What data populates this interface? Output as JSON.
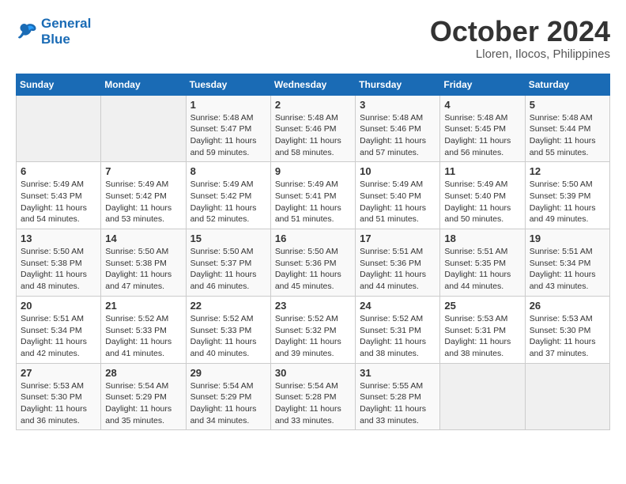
{
  "header": {
    "logo_line1": "General",
    "logo_line2": "Blue",
    "month": "October 2024",
    "location": "Lloren, Ilocos, Philippines"
  },
  "weekdays": [
    "Sunday",
    "Monday",
    "Tuesday",
    "Wednesday",
    "Thursday",
    "Friday",
    "Saturday"
  ],
  "weeks": [
    [
      {
        "day": "",
        "info": ""
      },
      {
        "day": "",
        "info": ""
      },
      {
        "day": "1",
        "info": "Sunrise: 5:48 AM\nSunset: 5:47 PM\nDaylight: 11 hours and 59 minutes."
      },
      {
        "day": "2",
        "info": "Sunrise: 5:48 AM\nSunset: 5:46 PM\nDaylight: 11 hours and 58 minutes."
      },
      {
        "day": "3",
        "info": "Sunrise: 5:48 AM\nSunset: 5:46 PM\nDaylight: 11 hours and 57 minutes."
      },
      {
        "day": "4",
        "info": "Sunrise: 5:48 AM\nSunset: 5:45 PM\nDaylight: 11 hours and 56 minutes."
      },
      {
        "day": "5",
        "info": "Sunrise: 5:48 AM\nSunset: 5:44 PM\nDaylight: 11 hours and 55 minutes."
      }
    ],
    [
      {
        "day": "6",
        "info": "Sunrise: 5:49 AM\nSunset: 5:43 PM\nDaylight: 11 hours and 54 minutes."
      },
      {
        "day": "7",
        "info": "Sunrise: 5:49 AM\nSunset: 5:42 PM\nDaylight: 11 hours and 53 minutes."
      },
      {
        "day": "8",
        "info": "Sunrise: 5:49 AM\nSunset: 5:42 PM\nDaylight: 11 hours and 52 minutes."
      },
      {
        "day": "9",
        "info": "Sunrise: 5:49 AM\nSunset: 5:41 PM\nDaylight: 11 hours and 51 minutes."
      },
      {
        "day": "10",
        "info": "Sunrise: 5:49 AM\nSunset: 5:40 PM\nDaylight: 11 hours and 51 minutes."
      },
      {
        "day": "11",
        "info": "Sunrise: 5:49 AM\nSunset: 5:40 PM\nDaylight: 11 hours and 50 minutes."
      },
      {
        "day": "12",
        "info": "Sunrise: 5:50 AM\nSunset: 5:39 PM\nDaylight: 11 hours and 49 minutes."
      }
    ],
    [
      {
        "day": "13",
        "info": "Sunrise: 5:50 AM\nSunset: 5:38 PM\nDaylight: 11 hours and 48 minutes."
      },
      {
        "day": "14",
        "info": "Sunrise: 5:50 AM\nSunset: 5:38 PM\nDaylight: 11 hours and 47 minutes."
      },
      {
        "day": "15",
        "info": "Sunrise: 5:50 AM\nSunset: 5:37 PM\nDaylight: 11 hours and 46 minutes."
      },
      {
        "day": "16",
        "info": "Sunrise: 5:50 AM\nSunset: 5:36 PM\nDaylight: 11 hours and 45 minutes."
      },
      {
        "day": "17",
        "info": "Sunrise: 5:51 AM\nSunset: 5:36 PM\nDaylight: 11 hours and 44 minutes."
      },
      {
        "day": "18",
        "info": "Sunrise: 5:51 AM\nSunset: 5:35 PM\nDaylight: 11 hours and 44 minutes."
      },
      {
        "day": "19",
        "info": "Sunrise: 5:51 AM\nSunset: 5:34 PM\nDaylight: 11 hours and 43 minutes."
      }
    ],
    [
      {
        "day": "20",
        "info": "Sunrise: 5:51 AM\nSunset: 5:34 PM\nDaylight: 11 hours and 42 minutes."
      },
      {
        "day": "21",
        "info": "Sunrise: 5:52 AM\nSunset: 5:33 PM\nDaylight: 11 hours and 41 minutes."
      },
      {
        "day": "22",
        "info": "Sunrise: 5:52 AM\nSunset: 5:33 PM\nDaylight: 11 hours and 40 minutes."
      },
      {
        "day": "23",
        "info": "Sunrise: 5:52 AM\nSunset: 5:32 PM\nDaylight: 11 hours and 39 minutes."
      },
      {
        "day": "24",
        "info": "Sunrise: 5:52 AM\nSunset: 5:31 PM\nDaylight: 11 hours and 38 minutes."
      },
      {
        "day": "25",
        "info": "Sunrise: 5:53 AM\nSunset: 5:31 PM\nDaylight: 11 hours and 38 minutes."
      },
      {
        "day": "26",
        "info": "Sunrise: 5:53 AM\nSunset: 5:30 PM\nDaylight: 11 hours and 37 minutes."
      }
    ],
    [
      {
        "day": "27",
        "info": "Sunrise: 5:53 AM\nSunset: 5:30 PM\nDaylight: 11 hours and 36 minutes."
      },
      {
        "day": "28",
        "info": "Sunrise: 5:54 AM\nSunset: 5:29 PM\nDaylight: 11 hours and 35 minutes."
      },
      {
        "day": "29",
        "info": "Sunrise: 5:54 AM\nSunset: 5:29 PM\nDaylight: 11 hours and 34 minutes."
      },
      {
        "day": "30",
        "info": "Sunrise: 5:54 AM\nSunset: 5:28 PM\nDaylight: 11 hours and 33 minutes."
      },
      {
        "day": "31",
        "info": "Sunrise: 5:55 AM\nSunset: 5:28 PM\nDaylight: 11 hours and 33 minutes."
      },
      {
        "day": "",
        "info": ""
      },
      {
        "day": "",
        "info": ""
      }
    ]
  ]
}
